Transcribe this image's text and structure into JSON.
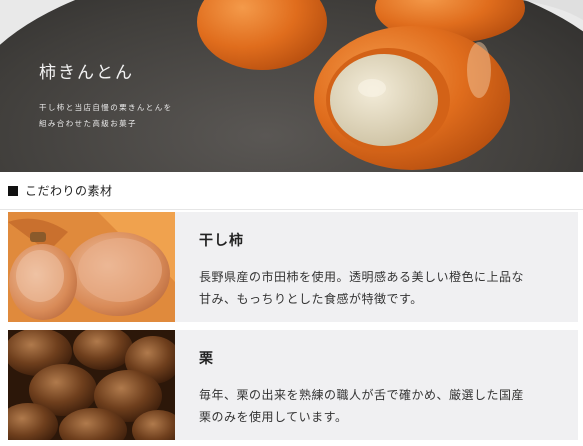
{
  "hero": {
    "title": "柿きんとん",
    "desc_line1": "干し柿と当店自慢の栗きんとんを",
    "desc_line2": "組み合わせた高級お菓子"
  },
  "section": {
    "title": "こだわりの素材",
    "icon": "black-square-icon"
  },
  "items": [
    {
      "heading": "干し柿",
      "body_line1": "長野県産の市田柿を使用。透明感ある美しい橙色に上品な",
      "body_line2": "甘み、もっちりとした食感が特徴です。",
      "image": "dried-persimmon-photo"
    },
    {
      "heading": "栗",
      "body_line1": "毎年、栗の出来を熟練の職人が舌で確かめ、厳選した国産",
      "body_line2": "栗のみを使用しています。",
      "image": "chestnuts-photo"
    }
  ],
  "colors": {
    "persimmon": "#e2701f",
    "chestnut_filling": "#e8dfc7",
    "plate": "#3d3b39",
    "card_bg": "#f0f0f2"
  }
}
